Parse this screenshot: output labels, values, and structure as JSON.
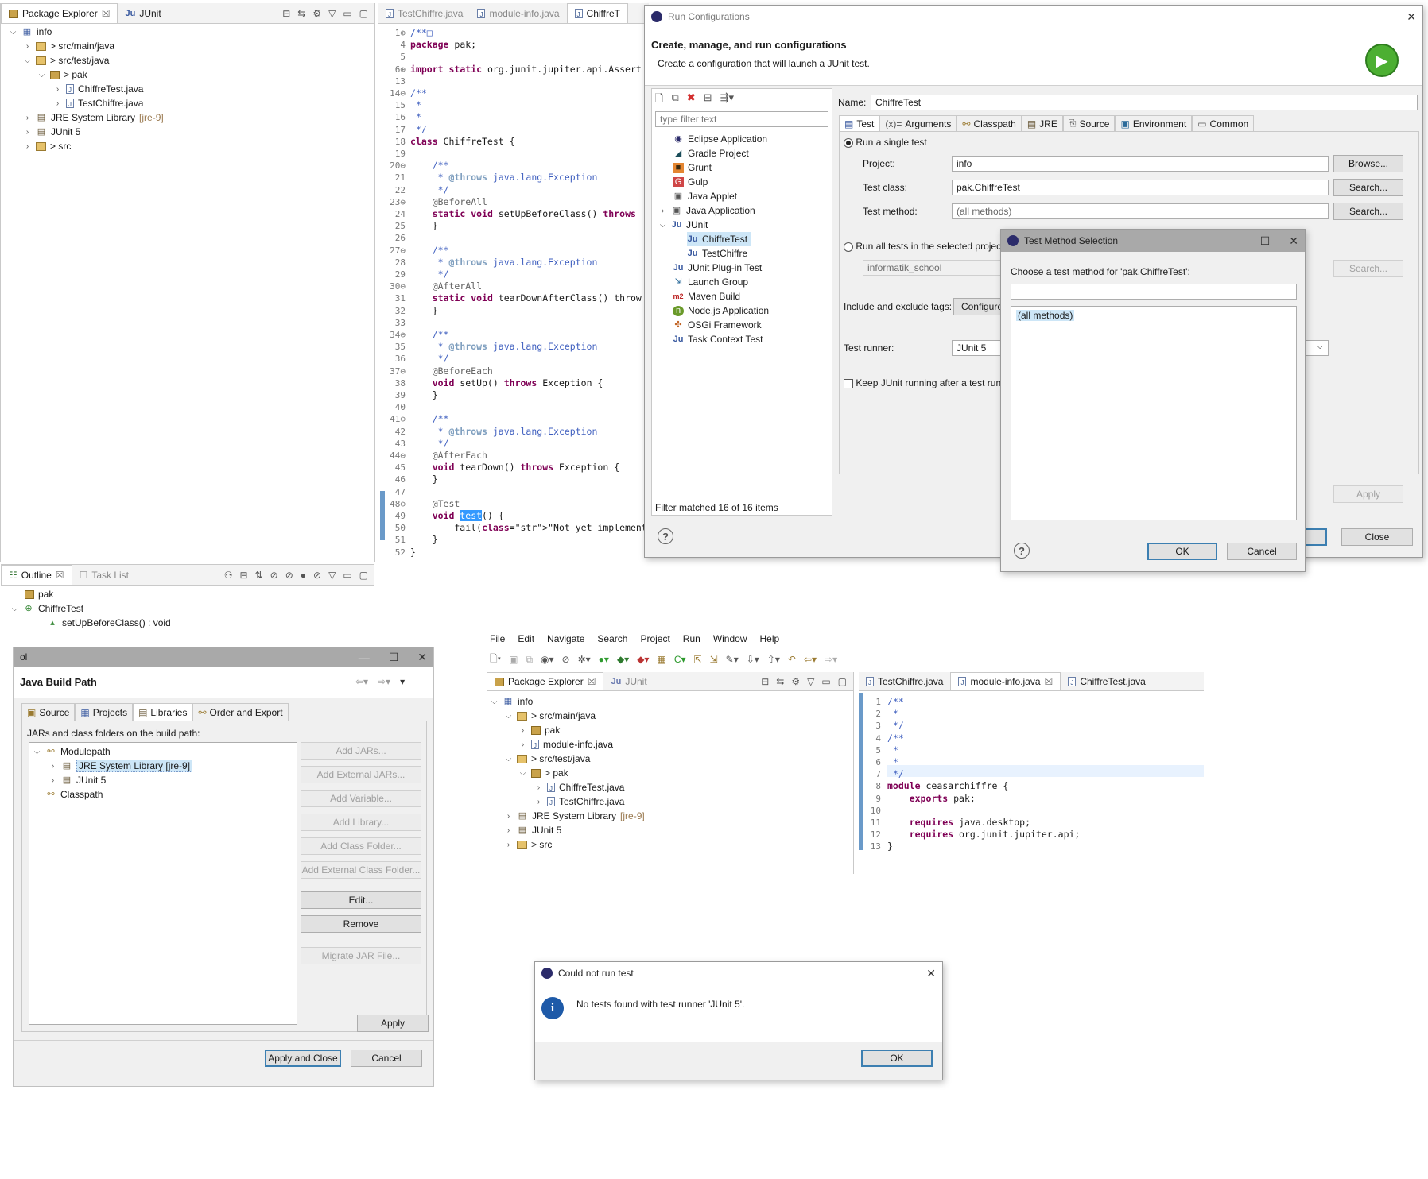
{
  "pe1": {
    "tabs": [
      {
        "label": "Package Explorer"
      },
      {
        "label": "JUnit"
      }
    ],
    "tree": [
      {
        "label": "info"
      },
      {
        "label": "> src/main/java"
      },
      {
        "label": "> src/test/java"
      },
      {
        "label": "> pak"
      },
      {
        "label": "ChiffreTest.java"
      },
      {
        "label": "TestChiffre.java"
      },
      {
        "label": "JRE System Library",
        "suffix": "[jre-9]"
      },
      {
        "label": "JUnit 5"
      },
      {
        "label": "> src"
      }
    ]
  },
  "outline": {
    "tabs": [
      {
        "label": "Outline"
      },
      {
        "label": "Task List"
      }
    ],
    "items": [
      {
        "label": "pak"
      },
      {
        "label": "ChiffreTest"
      },
      {
        "label": "setUpBeforeClass() : void"
      }
    ]
  },
  "editor1": {
    "tabs": [
      {
        "label": "TestChiffre.java"
      },
      {
        "label": "module-info.java"
      },
      {
        "label": "ChiffreT"
      }
    ],
    "lines": [
      {
        "n": "1⊕",
        "t": "/**□"
      },
      {
        "n": "4",
        "t": "package pak;"
      },
      {
        "n": "5",
        "t": ""
      },
      {
        "n": "6⊕",
        "t": "import static org.junit.jupiter.api.Assert"
      },
      {
        "n": "13",
        "t": ""
      },
      {
        "n": "14⊖",
        "t": "/**"
      },
      {
        "n": "15",
        "t": " *"
      },
      {
        "n": "16",
        "t": " *"
      },
      {
        "n": "17",
        "t": " */"
      },
      {
        "n": "18",
        "t": "class ChiffreTest {"
      },
      {
        "n": "19",
        "t": ""
      },
      {
        "n": "20⊖",
        "t": "    /**"
      },
      {
        "n": "21",
        "t": "     * @throws java.lang.Exception"
      },
      {
        "n": "22",
        "t": "     */"
      },
      {
        "n": "23⊖",
        "t": "    @BeforeAll"
      },
      {
        "n": "24",
        "t": "    static void setUpBeforeClass() throws"
      },
      {
        "n": "25",
        "t": "    }"
      },
      {
        "n": "26",
        "t": ""
      },
      {
        "n": "27⊖",
        "t": "    /**"
      },
      {
        "n": "28",
        "t": "     * @throws java.lang.Exception"
      },
      {
        "n": "29",
        "t": "     */"
      },
      {
        "n": "30⊖",
        "t": "    @AfterAll"
      },
      {
        "n": "31",
        "t": "    static void tearDownAfterClass() throw"
      },
      {
        "n": "32",
        "t": "    }"
      },
      {
        "n": "33",
        "t": ""
      },
      {
        "n": "34⊖",
        "t": "    /**"
      },
      {
        "n": "35",
        "t": "     * @throws java.lang.Exception"
      },
      {
        "n": "36",
        "t": "     */"
      },
      {
        "n": "37⊖",
        "t": "    @BeforeEach"
      },
      {
        "n": "38",
        "t": "    void setUp() throws Exception {"
      },
      {
        "n": "39",
        "t": "    }"
      },
      {
        "n": "40",
        "t": ""
      },
      {
        "n": "41⊖",
        "t": "    /**"
      },
      {
        "n": "42",
        "t": "     * @throws java.lang.Exception"
      },
      {
        "n": "43",
        "t": "     */"
      },
      {
        "n": "44⊖",
        "t": "    @AfterEach"
      },
      {
        "n": "45",
        "t": "    void tearDown() throws Exception {"
      },
      {
        "n": "46",
        "t": "    }"
      },
      {
        "n": "47",
        "t": ""
      },
      {
        "n": "48⊖",
        "t": "    @Test"
      },
      {
        "n": "49",
        "t": "    void test() {"
      },
      {
        "n": "50",
        "t": "        fail(\"Not yet implemented\");"
      },
      {
        "n": "51",
        "t": "    }"
      },
      {
        "n": "52",
        "t": "}"
      }
    ]
  },
  "runconfig": {
    "title": "Run Configurations",
    "heading": "Create, manage, and run configurations",
    "subheading": "Create a configuration that will launch a JUnit test.",
    "filter_placeholder": "type filter text",
    "types": [
      {
        "label": "Eclipse Application"
      },
      {
        "label": "Gradle Project"
      },
      {
        "label": "Grunt"
      },
      {
        "label": "Gulp"
      },
      {
        "label": "Java Applet"
      },
      {
        "label": "Java Application"
      },
      {
        "label": "JUnit"
      },
      {
        "label": "ChiffreTest"
      },
      {
        "label": "TestChiffre"
      },
      {
        "label": "JUnit Plug-in Test"
      },
      {
        "label": "Launch Group"
      },
      {
        "label": "Maven Build"
      },
      {
        "label": "Node.js Application"
      },
      {
        "label": "OSGi Framework"
      },
      {
        "label": "Task Context Test"
      }
    ],
    "filter_status": "Filter matched 16 of 16 items",
    "name_label": "Name:",
    "name_value": "ChiffreTest",
    "tabs": [
      {
        "label": "Test"
      },
      {
        "label": "Arguments"
      },
      {
        "label": "Classpath"
      },
      {
        "label": "JRE"
      },
      {
        "label": "Source"
      },
      {
        "label": "Environment"
      },
      {
        "label": "Common"
      }
    ],
    "run_single": "Run a single test",
    "project_label": "Project:",
    "project_value": "info",
    "browse": "Browse...",
    "testclass_label": "Test class:",
    "testclass_value": "pak.ChiffreTest",
    "search": "Search...",
    "testmethod_label": "Test method:",
    "testmethod_value": "(all methods)",
    "run_all": "Run all tests in the selected project",
    "run_all_value": "informatik_school",
    "tags_label": "Include and exclude tags:",
    "configure": "Configure...",
    "runner_label": "Test runner:",
    "runner_value": "JUnit 5",
    "keep_label": "Keep JUnit running after a test run",
    "apply": "Apply",
    "close": "Close"
  },
  "tms": {
    "title": "Test Method Selection",
    "prompt": "Choose a test method for 'pak.ChiffreTest':",
    "item": "(all methods)",
    "ok": "OK",
    "cancel": "Cancel"
  },
  "jbp": {
    "title_fragment": "ol",
    "heading": "Java Build Path",
    "tabs": [
      {
        "label": "Source"
      },
      {
        "label": "Projects"
      },
      {
        "label": "Libraries"
      },
      {
        "label": "Order and Export"
      }
    ],
    "caption": "JARs and class folders on the build path:",
    "tree": [
      {
        "label": "Modulepath"
      },
      {
        "label": "JRE System Library [jre-9]"
      },
      {
        "label": "JUnit 5"
      },
      {
        "label": "Classpath"
      }
    ],
    "buttons": [
      {
        "label": "Add JARs..."
      },
      {
        "label": "Add External JARs..."
      },
      {
        "label": "Add Variable..."
      },
      {
        "label": "Add Library..."
      },
      {
        "label": "Add Class Folder..."
      },
      {
        "label": "Add External Class Folder..."
      },
      {
        "label": "Edit..."
      },
      {
        "label": "Remove"
      },
      {
        "label": "Migrate JAR File..."
      }
    ],
    "apply": "Apply",
    "apply_close": "Apply and Close",
    "cancel": "Cancel"
  },
  "ide2": {
    "menu": [
      {
        "label": "File"
      },
      {
        "label": "Edit"
      },
      {
        "label": "Navigate"
      },
      {
        "label": "Search"
      },
      {
        "label": "Project"
      },
      {
        "label": "Run"
      },
      {
        "label": "Window"
      },
      {
        "label": "Help"
      }
    ],
    "pe_tabs": [
      {
        "label": "Package Explorer"
      },
      {
        "label": "JUnit"
      }
    ],
    "tree": [
      {
        "label": "info"
      },
      {
        "label": "> src/main/java"
      },
      {
        "label": "pak"
      },
      {
        "label": "module-info.java"
      },
      {
        "label": "> src/test/java"
      },
      {
        "label": "> pak"
      },
      {
        "label": "ChiffreTest.java"
      },
      {
        "label": "TestChiffre.java"
      },
      {
        "label": "JRE System Library",
        "suffix": "[jre-9]"
      },
      {
        "label": "JUnit 5"
      },
      {
        "label": "> src"
      }
    ],
    "editor_tabs": [
      {
        "label": "TestChiffre.java"
      },
      {
        "label": "module-info.java"
      },
      {
        "label": "ChiffreTest.java"
      }
    ],
    "lines": [
      {
        "n": "1",
        "t": "/**"
      },
      {
        "n": "2",
        "t": " *"
      },
      {
        "n": "3",
        "t": " */"
      },
      {
        "n": "4",
        "t": "/**"
      },
      {
        "n": "5",
        "t": " *"
      },
      {
        "n": "6",
        "t": " *"
      },
      {
        "n": "7",
        "t": " */"
      },
      {
        "n": "8",
        "t": "module ceasarchiffre {"
      },
      {
        "n": "9",
        "t": "    exports pak;"
      },
      {
        "n": "10",
        "t": ""
      },
      {
        "n": "11",
        "t": "    requires java.desktop;"
      },
      {
        "n": "12",
        "t": "    requires org.junit.jupiter.api;"
      },
      {
        "n": "13",
        "t": "}"
      }
    ]
  },
  "err": {
    "title": "Could not run test",
    "message": "No tests found with test runner 'JUnit 5'.",
    "ok": "OK"
  }
}
